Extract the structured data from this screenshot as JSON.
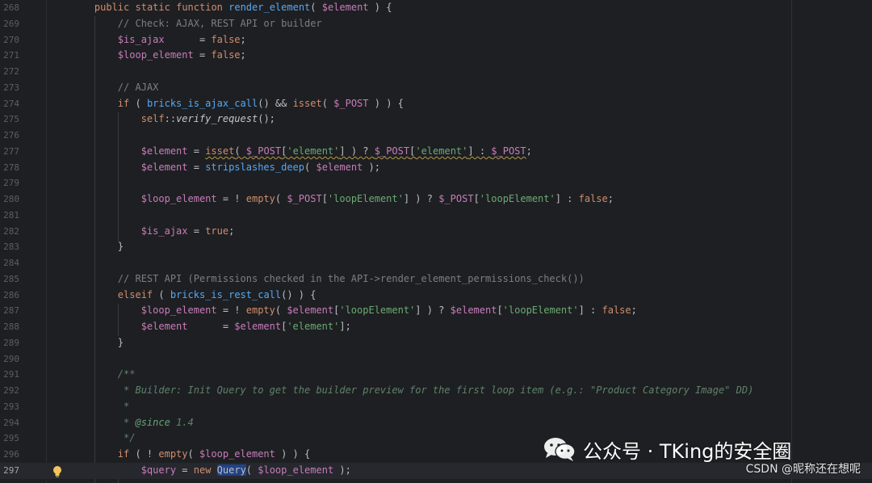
{
  "editor": {
    "current_line": "297",
    "lines": [
      {
        "no": "268",
        "tokens": [
          {
            "t": "    "
          },
          {
            "t": "public",
            "c": "kw"
          },
          {
            "t": " "
          },
          {
            "t": "static",
            "c": "kw"
          },
          {
            "t": " "
          },
          {
            "t": "function",
            "c": "kw"
          },
          {
            "t": " "
          },
          {
            "t": "render_element",
            "c": "fn"
          },
          {
            "t": "( "
          },
          {
            "t": "$element",
            "c": "var"
          },
          {
            "t": " ) {"
          }
        ]
      },
      {
        "no": "269",
        "tokens": [
          {
            "t": "        "
          },
          {
            "t": "// Check: AJAX, REST API or builder",
            "c": "cm"
          }
        ]
      },
      {
        "no": "270",
        "tokens": [
          {
            "t": "        "
          },
          {
            "t": "$is_ajax",
            "c": "var"
          },
          {
            "t": "      = "
          },
          {
            "t": "false",
            "c": "kw"
          },
          {
            "t": ";"
          }
        ]
      },
      {
        "no": "271",
        "tokens": [
          {
            "t": "        "
          },
          {
            "t": "$loop_element",
            "c": "var"
          },
          {
            "t": " = "
          },
          {
            "t": "false",
            "c": "kw"
          },
          {
            "t": ";"
          }
        ]
      },
      {
        "no": "272",
        "tokens": []
      },
      {
        "no": "273",
        "tokens": [
          {
            "t": "        "
          },
          {
            "t": "// AJAX",
            "c": "cm"
          }
        ]
      },
      {
        "no": "274",
        "tokens": [
          {
            "t": "        "
          },
          {
            "t": "if",
            "c": "kw"
          },
          {
            "t": " ( "
          },
          {
            "t": "bricks_is_ajax_call",
            "c": "fn"
          },
          {
            "t": "() && "
          },
          {
            "t": "isset",
            "c": "kw"
          },
          {
            "t": "( "
          },
          {
            "t": "$_POST",
            "c": "var"
          },
          {
            "t": " ) ) {"
          }
        ]
      },
      {
        "no": "275",
        "tokens": [
          {
            "t": "            "
          },
          {
            "t": "self",
            "c": "kw"
          },
          {
            "t": "::"
          },
          {
            "t": "verify_request",
            "c": "static"
          },
          {
            "t": "();"
          }
        ]
      },
      {
        "no": "276",
        "tokens": []
      },
      {
        "no": "277",
        "tokens": [
          {
            "t": "            "
          },
          {
            "t": "$element",
            "c": "var"
          },
          {
            "t": " = "
          },
          {
            "t": "isset",
            "c": "kw",
            "w": true
          },
          {
            "t": "( ",
            "w": true
          },
          {
            "t": "$_POST",
            "c": "var",
            "w": true
          },
          {
            "t": "[",
            "w": true
          },
          {
            "t": "'element'",
            "c": "str",
            "w": true
          },
          {
            "t": "] ) ? ",
            "w": true
          },
          {
            "t": "$_POST",
            "c": "var",
            "w": true
          },
          {
            "t": "[",
            "w": true
          },
          {
            "t": "'element'",
            "c": "str",
            "w": true
          },
          {
            "t": "] : ",
            "w": true
          },
          {
            "t": "$_POST",
            "c": "var",
            "w": true
          },
          {
            "t": ";"
          }
        ]
      },
      {
        "no": "278",
        "tokens": [
          {
            "t": "            "
          },
          {
            "t": "$element",
            "c": "var"
          },
          {
            "t": " = "
          },
          {
            "t": "stripslashes_deep",
            "c": "fn"
          },
          {
            "t": "( "
          },
          {
            "t": "$element",
            "c": "var"
          },
          {
            "t": " );"
          }
        ]
      },
      {
        "no": "279",
        "tokens": []
      },
      {
        "no": "280",
        "tokens": [
          {
            "t": "            "
          },
          {
            "t": "$loop_element",
            "c": "var"
          },
          {
            "t": " = ! "
          },
          {
            "t": "empty",
            "c": "kw"
          },
          {
            "t": "( "
          },
          {
            "t": "$_POST",
            "c": "var"
          },
          {
            "t": "["
          },
          {
            "t": "'loopElement'",
            "c": "str"
          },
          {
            "t": "] ) ? "
          },
          {
            "t": "$_POST",
            "c": "var"
          },
          {
            "t": "["
          },
          {
            "t": "'loopElement'",
            "c": "str"
          },
          {
            "t": "] : "
          },
          {
            "t": "false",
            "c": "kw"
          },
          {
            "t": ";"
          }
        ]
      },
      {
        "no": "281",
        "tokens": []
      },
      {
        "no": "282",
        "tokens": [
          {
            "t": "            "
          },
          {
            "t": "$is_ajax",
            "c": "var"
          },
          {
            "t": " = "
          },
          {
            "t": "true",
            "c": "kw"
          },
          {
            "t": ";"
          }
        ]
      },
      {
        "no": "283",
        "tokens": [
          {
            "t": "        }"
          }
        ]
      },
      {
        "no": "284",
        "tokens": []
      },
      {
        "no": "285",
        "tokens": [
          {
            "t": "        "
          },
          {
            "t": "// REST API (Permissions checked in the API->render_element_permissions_check())",
            "c": "cm"
          }
        ]
      },
      {
        "no": "286",
        "tokens": [
          {
            "t": "        "
          },
          {
            "t": "elseif",
            "c": "kw"
          },
          {
            "t": " ( "
          },
          {
            "t": "bricks_is_rest_call",
            "c": "fn"
          },
          {
            "t": "() ) {"
          }
        ]
      },
      {
        "no": "287",
        "tokens": [
          {
            "t": "            "
          },
          {
            "t": "$loop_element",
            "c": "var"
          },
          {
            "t": " = ! "
          },
          {
            "t": "empty",
            "c": "kw"
          },
          {
            "t": "( "
          },
          {
            "t": "$element",
            "c": "var"
          },
          {
            "t": "["
          },
          {
            "t": "'loopElement'",
            "c": "str"
          },
          {
            "t": "] ) ? "
          },
          {
            "t": "$element",
            "c": "var"
          },
          {
            "t": "["
          },
          {
            "t": "'loopElement'",
            "c": "str"
          },
          {
            "t": "] : "
          },
          {
            "t": "false",
            "c": "kw"
          },
          {
            "t": ";"
          }
        ]
      },
      {
        "no": "288",
        "tokens": [
          {
            "t": "            "
          },
          {
            "t": "$element",
            "c": "var"
          },
          {
            "t": "      = "
          },
          {
            "t": "$element",
            "c": "var"
          },
          {
            "t": "["
          },
          {
            "t": "'element'",
            "c": "str"
          },
          {
            "t": "];"
          }
        ]
      },
      {
        "no": "289",
        "tokens": [
          {
            "t": "        }"
          }
        ]
      },
      {
        "no": "290",
        "tokens": []
      },
      {
        "no": "291",
        "tokens": [
          {
            "t": "        "
          },
          {
            "t": "/**",
            "c": "doc"
          }
        ]
      },
      {
        "no": "292",
        "tokens": [
          {
            "t": "         "
          },
          {
            "t": "* Builder: Init Query to get the builder preview for the first loop item (e.g.: \"Product Category Image\" DD)",
            "c": "doc"
          }
        ]
      },
      {
        "no": "293",
        "tokens": [
          {
            "t": "         "
          },
          {
            "t": "*",
            "c": "doc"
          }
        ]
      },
      {
        "no": "294",
        "tokens": [
          {
            "t": "         "
          },
          {
            "t": "* ",
            "c": "doc"
          },
          {
            "t": "@since",
            "c": "doctag"
          },
          {
            "t": " 1.4",
            "c": "doc"
          }
        ]
      },
      {
        "no": "295",
        "tokens": [
          {
            "t": "         "
          },
          {
            "t": "*/",
            "c": "doc"
          }
        ]
      },
      {
        "no": "296",
        "tokens": [
          {
            "t": "        "
          },
          {
            "t": "if",
            "c": "kw"
          },
          {
            "t": " ( ! "
          },
          {
            "t": "empty",
            "c": "kw"
          },
          {
            "t": "( "
          },
          {
            "t": "$loop_element",
            "c": "var"
          },
          {
            "t": " ) ) {"
          }
        ]
      },
      {
        "no": "297",
        "tokens": [
          {
            "t": "            "
          },
          {
            "t": "$query",
            "c": "var"
          },
          {
            "t": " = "
          },
          {
            "t": "new",
            "c": "kw"
          },
          {
            "t": " "
          },
          {
            "t": "Query",
            "c": "plain",
            "sel": true
          },
          {
            "t": "( "
          },
          {
            "t": "$loop_element",
            "c": "var"
          },
          {
            "t": " );"
          }
        ]
      }
    ]
  },
  "intention_icon": "lightbulb-icon",
  "watermark": {
    "logo_icon": "wechat-icon",
    "text": "公众号 · TKing的安全圈"
  },
  "csdn_credit": "CSDN @昵称还在想呢",
  "colors": {
    "background": "#1e1f22",
    "keyword": "#cf8e6d",
    "variable": "#c77dbb",
    "function": "#56a8f5",
    "string": "#6aab73",
    "comment": "#7a7e85",
    "doc_comment": "#5f826b",
    "selection": "#214283"
  }
}
